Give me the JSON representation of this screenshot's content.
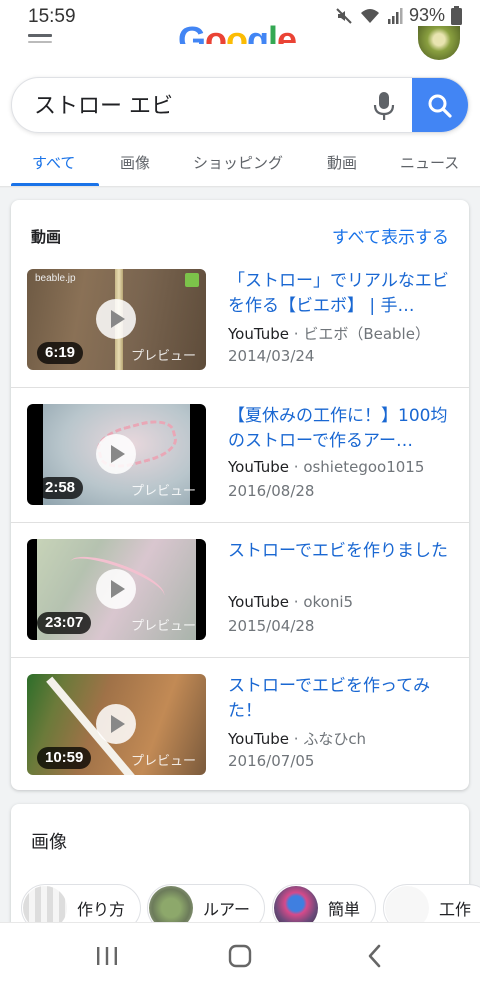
{
  "status_bar": {
    "time": "15:59",
    "battery": "93%"
  },
  "header": {
    "logo_letters": [
      "G",
      "o",
      "o",
      "g",
      "l",
      "e"
    ],
    "search": {
      "value": "ストロー エビ",
      "placeholder": ""
    },
    "tabs": [
      "すべて",
      "画像",
      "ショッピング",
      "動画",
      "ニュース"
    ],
    "active_tab": "すべて"
  },
  "videos": {
    "title": "動画",
    "see_all": "すべて表示する",
    "preview_label": "プレビュー",
    "items": [
      {
        "title": "「ストロー」でリアルなエビを作る【ビエボ】 | 手…",
        "source": "YouTube",
        "channel": "ビエボ（Beable）",
        "date": "2014/03/24",
        "duration": "6:19",
        "thumb_text": "beable.jp"
      },
      {
        "title": "【夏休みの工作に！】100均のストローで作るアー…",
        "source": "YouTube",
        "channel": "oshietegoo1015",
        "date": "2016/08/28",
        "duration": "2:58"
      },
      {
        "title": "ストローでエビを作りました",
        "source": "YouTube",
        "channel": "okoni5",
        "date": "2015/04/28",
        "duration": "23:07"
      },
      {
        "title": "ストローでエビを作ってみた！",
        "source": "YouTube",
        "channel": "ふなひch",
        "date": "2016/07/05",
        "duration": "10:59"
      }
    ]
  },
  "images": {
    "title": "画像",
    "chips": [
      "作り方",
      "ルアー",
      "簡単",
      "工作"
    ]
  },
  "colors": {
    "accent": "#1a73e8",
    "search_button": "#4285f4",
    "link": "#1967d2"
  },
  "icons": [
    "mute-icon",
    "wifi-icon",
    "signal-icon",
    "battery-icon",
    "menu-icon",
    "mic-icon",
    "search-icon",
    "recent-apps-icon",
    "home-icon",
    "back-icon",
    "play-icon"
  ]
}
